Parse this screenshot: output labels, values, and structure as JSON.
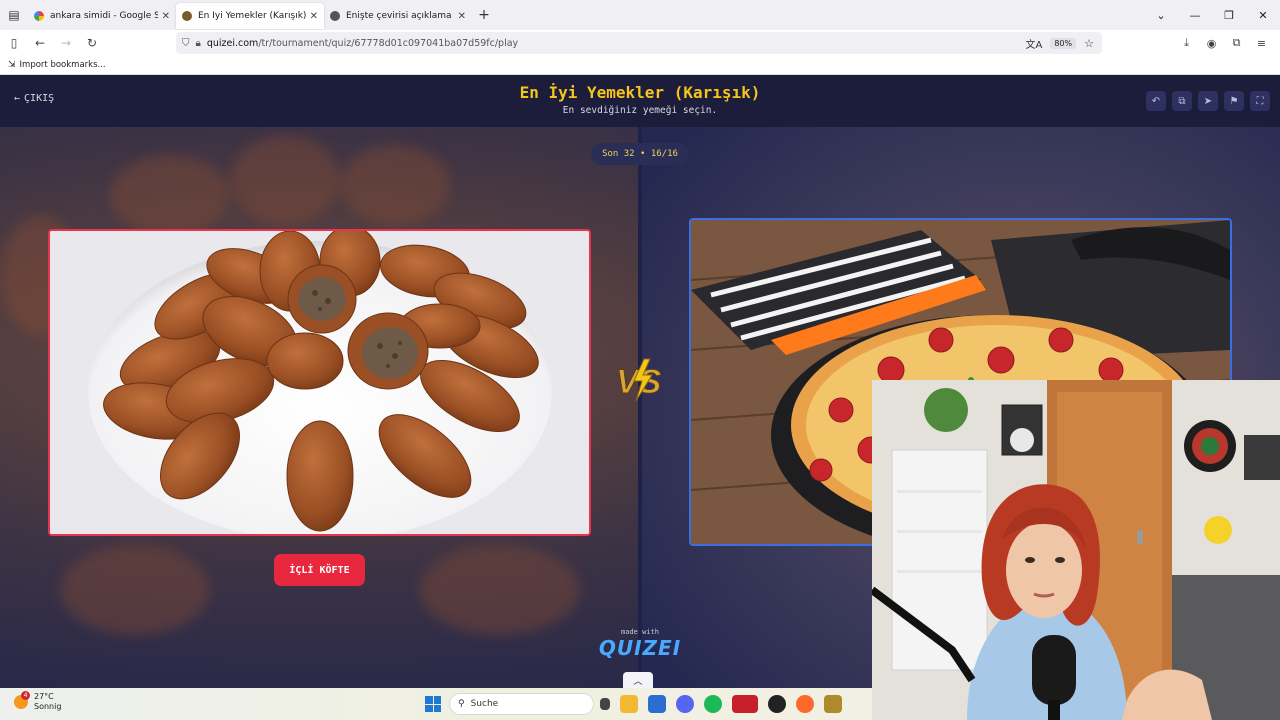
{
  "browser": {
    "tabs": [
      {
        "title": "ankara simidi - Google Search",
        "active": false
      },
      {
        "title": "En İyi Yemekler (Karışık) - Quizei",
        "active": true
      },
      {
        "title": "Enişte çevirisi açıklama",
        "active": false
      }
    ],
    "url_host": "quizei.com",
    "url_path": "/tr/tournament/quiz/67778d01c097041ba07d59fc/play",
    "zoom": "80%",
    "bookmark": "Import bookmarks..."
  },
  "quiz": {
    "exit_label": "ÇIKIŞ",
    "title": "En İyi Yemekler (Karışık)",
    "subtitle": "En sevdiğiniz yemeği seçin.",
    "round": "Son 32 • 16/16",
    "left_choice_label": "İÇLİ KÖFTE",
    "vs": "VS",
    "made_with": "made with",
    "brand": "QUIZEI"
  },
  "taskbar": {
    "temperature": "27°C",
    "weather_desc": "Sonnig",
    "notification_count": "4",
    "search_placeholder": "Suche"
  },
  "colors": {
    "title_yellow": "#f5c518",
    "left_border": "#e8344e",
    "right_border": "#3b6fe0",
    "choice_button": "#e8283f",
    "header_bg": "#1b1d3a"
  }
}
